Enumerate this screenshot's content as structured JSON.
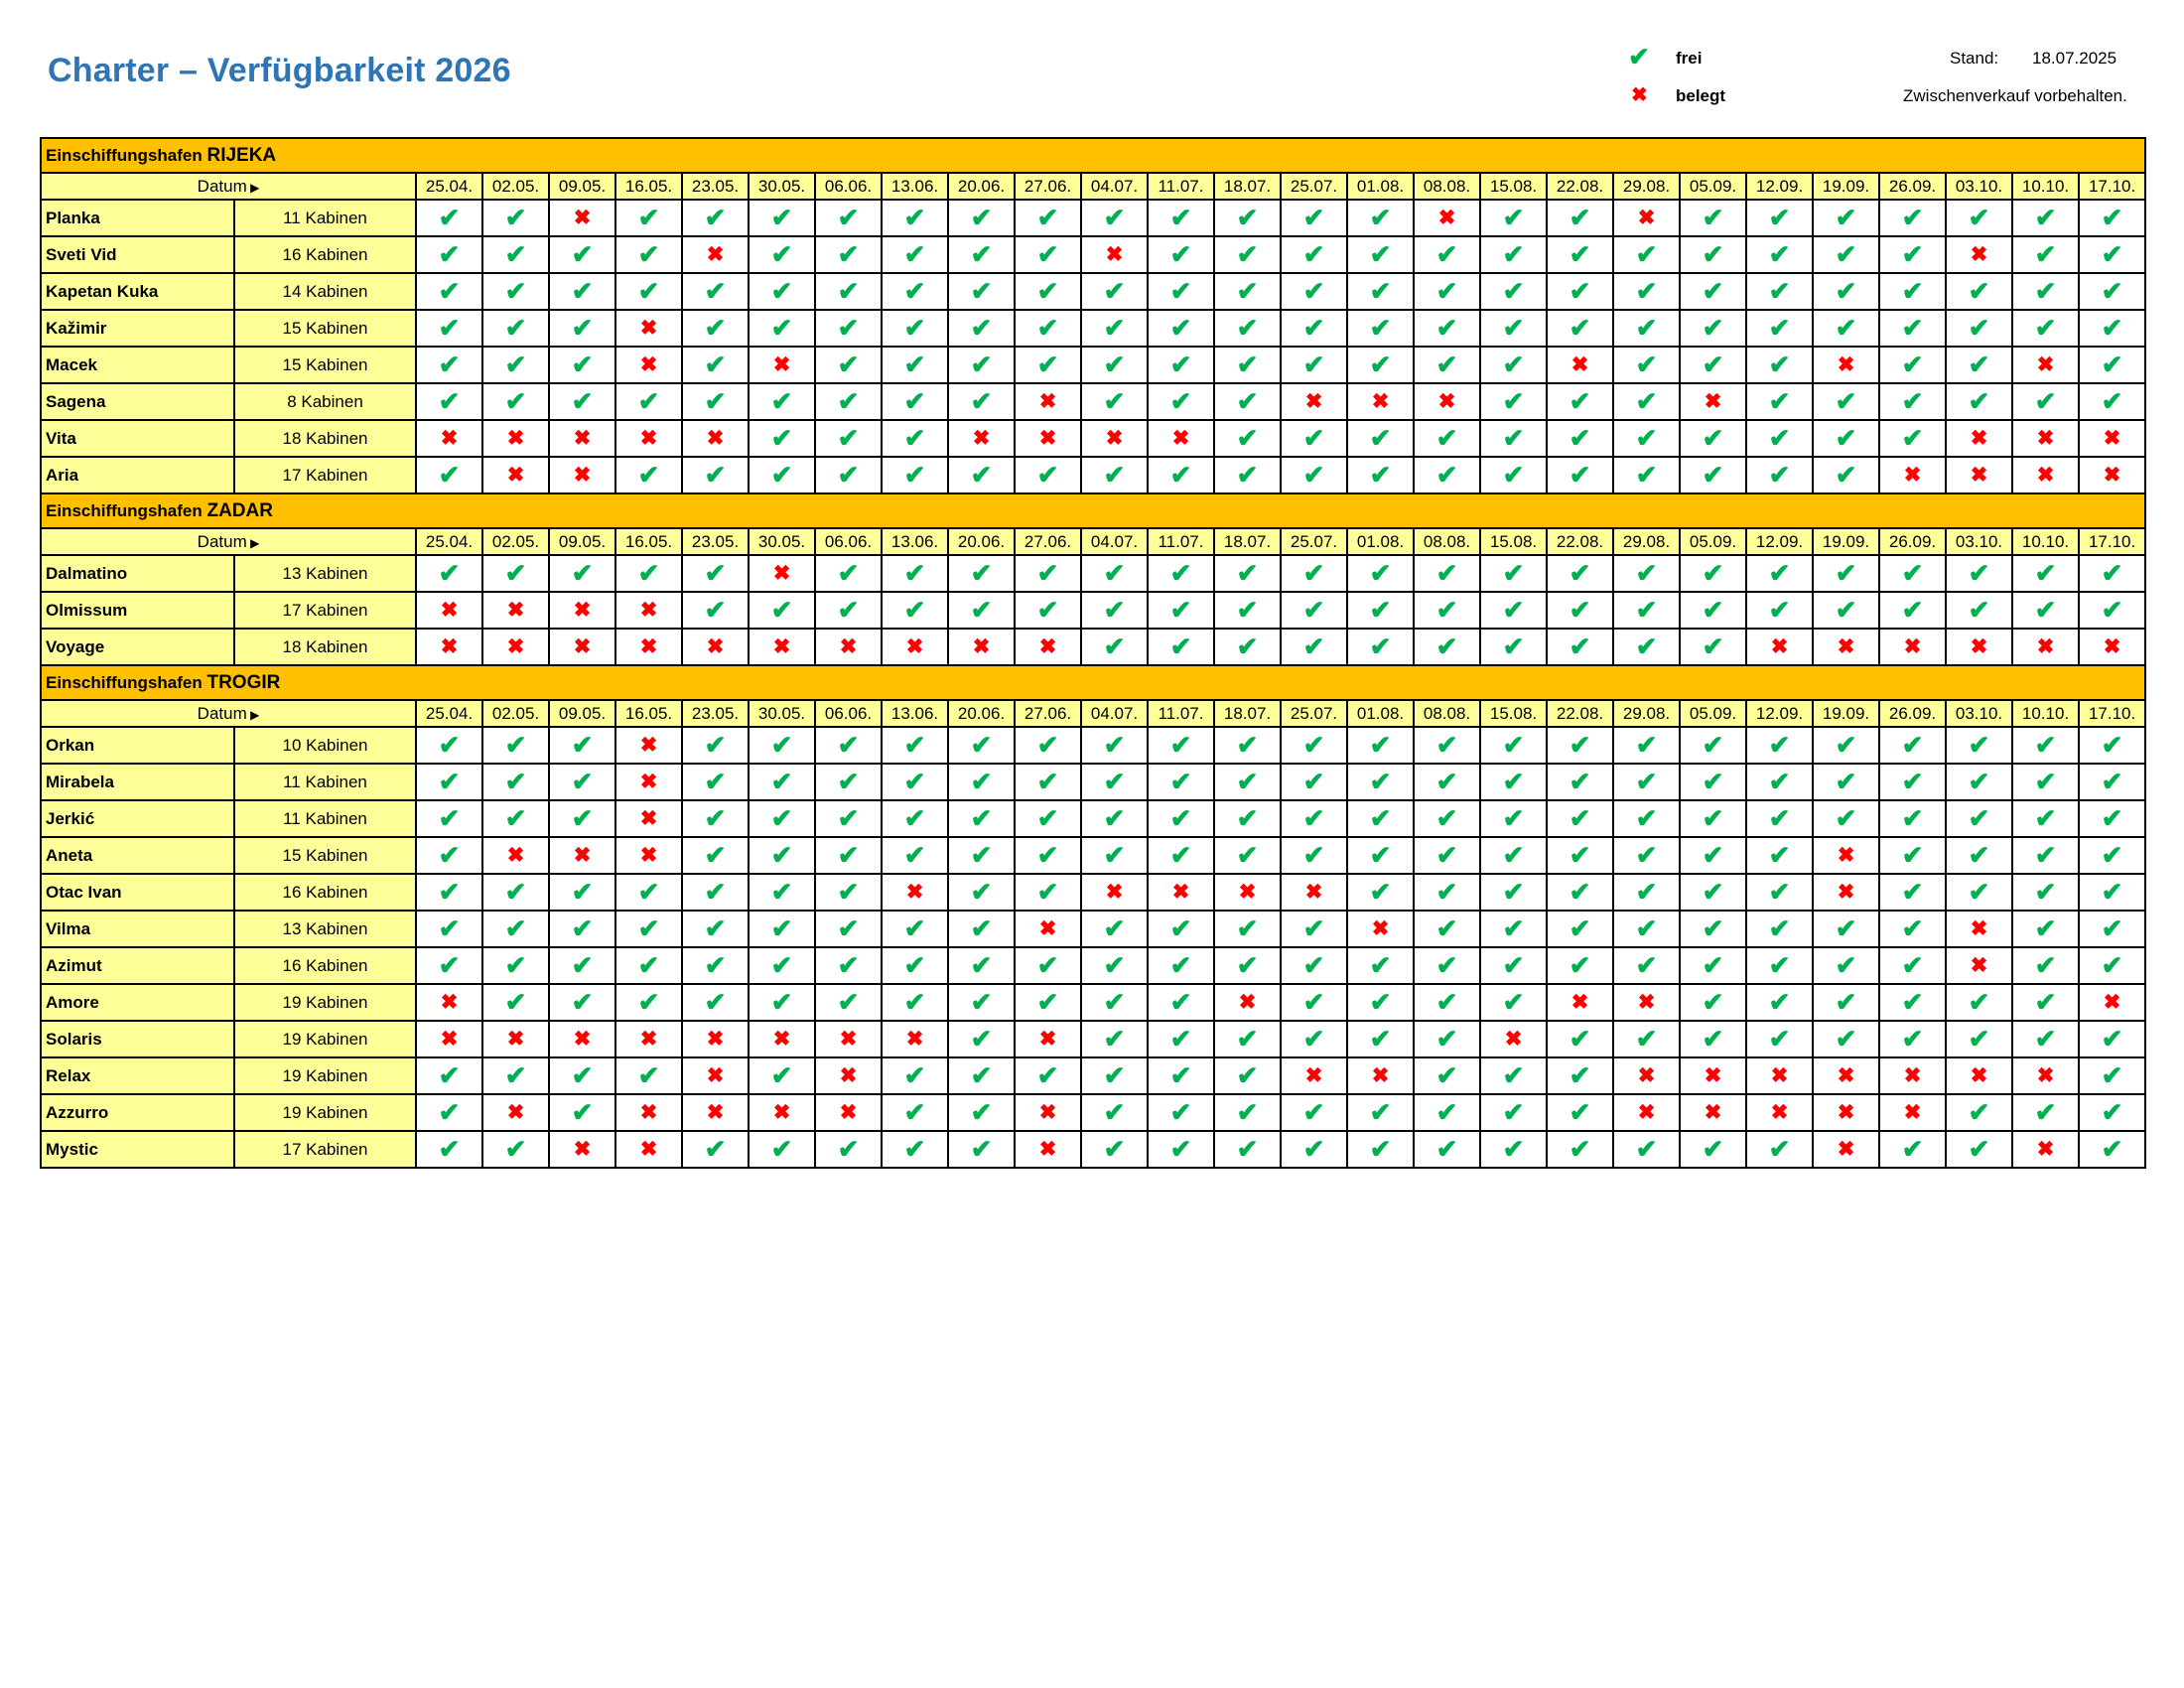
{
  "title": "Charter – Verfügbarkeit 2026",
  "legend": {
    "free_symbol": "✔",
    "free_label": "frei",
    "booked_symbol": "✖",
    "booked_label": "belegt",
    "free_color": "#00b050",
    "booked_color": "#ff0000"
  },
  "stand_label": "Stand:",
  "stand_date": "18.07.2025",
  "disclaimer": "Zwischenverkauf vorbehalten.",
  "colors": {
    "title": "#2e75b6",
    "port_header": "#ffc000",
    "label_cells": "#ffff99"
  },
  "datum_label": "Datum",
  "dates": [
    "25.04.",
    "02.05.",
    "09.05.",
    "16.05.",
    "23.05.",
    "30.05.",
    "06.06.",
    "13.06.",
    "20.06.",
    "27.06.",
    "04.07.",
    "11.07.",
    "18.07.",
    "25.07.",
    "01.08.",
    "08.08.",
    "15.08.",
    "22.08.",
    "29.08.",
    "05.09.",
    "12.09.",
    "19.09.",
    "26.09.",
    "03.10.",
    "10.10.",
    "17.10."
  ],
  "sections": [
    {
      "prefix": "Einschiffungshafen",
      "port": "RIJEKA",
      "boats": [
        {
          "name": "Planka",
          "cabins": "11 Kabinen",
          "avail": "11011111111111101101111111"
        },
        {
          "name": "Sveti Vid",
          "cabins": "16 Kabinen",
          "avail": "11110111110111111111111011"
        },
        {
          "name": "Kapetan Kuka",
          "cabins": "14 Kabinen",
          "avail": "11111111111111111111111111"
        },
        {
          "name": "Kažimir",
          "cabins": "15 Kabinen",
          "avail": "11101111111111111111111111"
        },
        {
          "name": "Macek",
          "cabins": "15 Kabinen",
          "avail": "11101011111111111011101101"
        },
        {
          "name": "Sagena",
          "cabins": "8 Kabinen",
          "avail": "11111111101110001110111111"
        },
        {
          "name": "Vita",
          "cabins": "18 Kabinen",
          "avail": "00000111000011111111111000"
        },
        {
          "name": "Aria",
          "cabins": "17 Kabinen",
          "avail": "10011111111111111111110000"
        }
      ]
    },
    {
      "prefix": "Einschiffungshafen",
      "port": "ZADAR",
      "boats": [
        {
          "name": "Dalmatino",
          "cabins": "13 Kabinen",
          "avail": "11111011111111111111111111"
        },
        {
          "name": "Olmissum",
          "cabins": "17 Kabinen",
          "avail": "00001111111111111111111111"
        },
        {
          "name": "Voyage",
          "cabins": "18 Kabinen",
          "avail": "00000000001111111111000000"
        }
      ]
    },
    {
      "prefix": "Einschiffungshafen",
      "port": "TROGIR",
      "boats": [
        {
          "name": "Orkan",
          "cabins": "10 Kabinen",
          "avail": "11101111111111111111111111"
        },
        {
          "name": "Mirabela",
          "cabins": "11 Kabinen",
          "avail": "11101111111111111111111111"
        },
        {
          "name": "Jerkić",
          "cabins": "11 Kabinen",
          "avail": "11101111111111111111111111"
        },
        {
          "name": "Aneta",
          "cabins": "15 Kabinen",
          "avail": "10001111111111111111101111"
        },
        {
          "name": "Otac Ivan",
          "cabins": "16 Kabinen",
          "avail": "11111110110000111111101111"
        },
        {
          "name": "Vilma",
          "cabins": "13 Kabinen",
          "avail": "11111111101111011111111011"
        },
        {
          "name": "Azimut",
          "cabins": "16 Kabinen",
          "avail": "11111111111111111111111011"
        },
        {
          "name": "Amore",
          "cabins": "19 Kabinen",
          "avail": "01111111111101111001111110"
        },
        {
          "name": "Solaris",
          "cabins": "19 Kabinen",
          "avail": "00000000101111110111111111"
        },
        {
          "name": "Relax",
          "cabins": "19 Kabinen",
          "avail": "11110101111110011100000001"
        },
        {
          "name": "Azzurro",
          "cabins": "19 Kabinen",
          "avail": "10100001101111111100000111"
        },
        {
          "name": "Mystic",
          "cabins": "17 Kabinen",
          "avail": "11001111101111111111101101"
        }
      ]
    }
  ]
}
